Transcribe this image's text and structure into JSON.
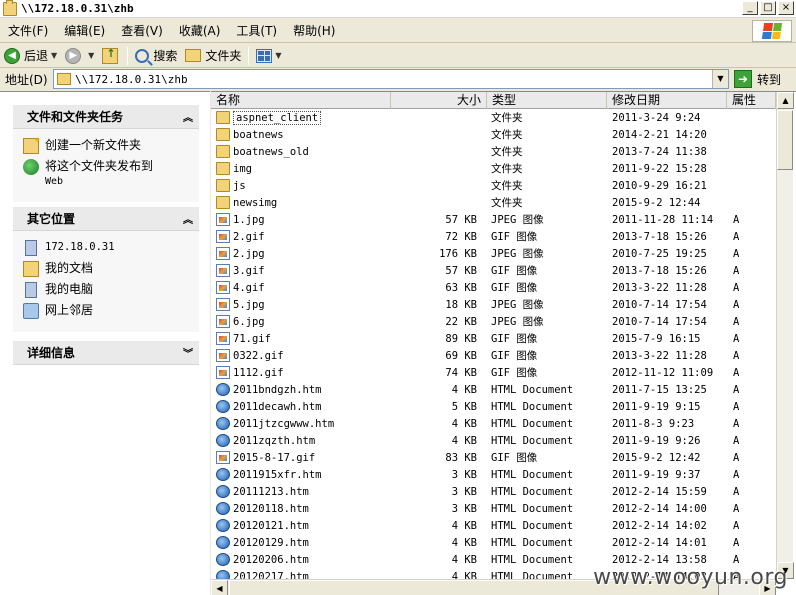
{
  "window": {
    "title": "\\\\172.18.0.31\\zhb"
  },
  "menu": [
    "文件(F)",
    "编辑(E)",
    "查看(V)",
    "收藏(A)",
    "工具(T)",
    "帮助(H)"
  ],
  "toolbar": {
    "back": "后退",
    "search": "搜索",
    "folders": "文件夹"
  },
  "address": {
    "label": "地址(D)",
    "value": "\\\\172.18.0.31\\zhb",
    "go": "转到"
  },
  "tasks": {
    "title": "文件和文件夹任务",
    "items": [
      {
        "label": "创建一个新文件夹",
        "label2": ""
      },
      {
        "label": "将这个文件夹发布到",
        "label2": "Web"
      }
    ]
  },
  "places": {
    "title": "其它位置",
    "items": [
      "172.18.0.31",
      "我的文档",
      "我的电脑",
      "网上邻居"
    ]
  },
  "details": {
    "title": "详细信息"
  },
  "columns": {
    "name": "名称",
    "size": "大小",
    "type": "类型",
    "date": "修改日期",
    "attr": "属性"
  },
  "files": [
    {
      "name": "aspnet_client",
      "size": "",
      "type": "文件夹",
      "date": "2011-3-24 9:24",
      "attr": "",
      "icon": "folder"
    },
    {
      "name": "boatnews",
      "size": "",
      "type": "文件夹",
      "date": "2014-2-21 14:20",
      "attr": "",
      "icon": "folder"
    },
    {
      "name": "boatnews_old",
      "size": "",
      "type": "文件夹",
      "date": "2013-7-24 11:38",
      "attr": "",
      "icon": "folder"
    },
    {
      "name": "img",
      "size": "",
      "type": "文件夹",
      "date": "2011-9-22 15:28",
      "attr": "",
      "icon": "folder"
    },
    {
      "name": "js",
      "size": "",
      "type": "文件夹",
      "date": "2010-9-29 16:21",
      "attr": "",
      "icon": "folder"
    },
    {
      "name": "newsimg",
      "size": "",
      "type": "文件夹",
      "date": "2015-9-2 12:44",
      "attr": "",
      "icon": "folder"
    },
    {
      "name": "1.jpg",
      "size": "57 KB",
      "type": "JPEG 图像",
      "date": "2011-11-28 11:14",
      "attr": "A",
      "icon": "image"
    },
    {
      "name": "2.gif",
      "size": "72 KB",
      "type": "GIF 图像",
      "date": "2013-7-18 15:26",
      "attr": "A",
      "icon": "image"
    },
    {
      "name": "2.jpg",
      "size": "176 KB",
      "type": "JPEG 图像",
      "date": "2010-7-25 19:25",
      "attr": "A",
      "icon": "image"
    },
    {
      "name": "3.gif",
      "size": "57 KB",
      "type": "GIF 图像",
      "date": "2013-7-18 15:26",
      "attr": "A",
      "icon": "image"
    },
    {
      "name": "4.gif",
      "size": "63 KB",
      "type": "GIF 图像",
      "date": "2013-3-22 11:28",
      "attr": "A",
      "icon": "image"
    },
    {
      "name": "5.jpg",
      "size": "18 KB",
      "type": "JPEG 图像",
      "date": "2010-7-14 17:54",
      "attr": "A",
      "icon": "image"
    },
    {
      "name": "6.jpg",
      "size": "22 KB",
      "type": "JPEG 图像",
      "date": "2010-7-14 17:54",
      "attr": "A",
      "icon": "image"
    },
    {
      "name": "71.gif",
      "size": "89 KB",
      "type": "GIF 图像",
      "date": "2015-7-9 16:15",
      "attr": "A",
      "icon": "image"
    },
    {
      "name": "0322.gif",
      "size": "69 KB",
      "type": "GIF 图像",
      "date": "2013-3-22 11:28",
      "attr": "A",
      "icon": "image"
    },
    {
      "name": "1112.gif",
      "size": "74 KB",
      "type": "GIF 图像",
      "date": "2012-11-12 11:09",
      "attr": "A",
      "icon": "image"
    },
    {
      "name": "2011bndgzh.htm",
      "size": "4 KB",
      "type": "HTML Document",
      "date": "2011-7-15 13:25",
      "attr": "A",
      "icon": "html"
    },
    {
      "name": "2011decawh.htm",
      "size": "5 KB",
      "type": "HTML Document",
      "date": "2011-9-19 9:15",
      "attr": "A",
      "icon": "html"
    },
    {
      "name": "2011jtzcgwww.htm",
      "size": "4 KB",
      "type": "HTML Document",
      "date": "2011-8-3 9:23",
      "attr": "A",
      "icon": "html"
    },
    {
      "name": "2011zqzth.htm",
      "size": "4 KB",
      "type": "HTML Document",
      "date": "2011-9-19 9:26",
      "attr": "A",
      "icon": "html"
    },
    {
      "name": "2015-8-17.gif",
      "size": "83 KB",
      "type": "GIF 图像",
      "date": "2015-9-2 12:42",
      "attr": "A",
      "icon": "image"
    },
    {
      "name": "2011915xfr.htm",
      "size": "3 KB",
      "type": "HTML Document",
      "date": "2011-9-19 9:37",
      "attr": "A",
      "icon": "html"
    },
    {
      "name": "20111213.htm",
      "size": "3 KB",
      "type": "HTML Document",
      "date": "2012-2-14 15:59",
      "attr": "A",
      "icon": "html"
    },
    {
      "name": "20120118.htm",
      "size": "3 KB",
      "type": "HTML Document",
      "date": "2012-2-14 14:00",
      "attr": "A",
      "icon": "html"
    },
    {
      "name": "20120121.htm",
      "size": "4 KB",
      "type": "HTML Document",
      "date": "2012-2-14 14:02",
      "attr": "A",
      "icon": "html"
    },
    {
      "name": "20120129.htm",
      "size": "4 KB",
      "type": "HTML Document",
      "date": "2012-2-14 14:01",
      "attr": "A",
      "icon": "html"
    },
    {
      "name": "20120206.htm",
      "size": "4 KB",
      "type": "HTML Document",
      "date": "2012-2-14 13:58",
      "attr": "A",
      "icon": "html"
    },
    {
      "name": "20120217.htm",
      "size": "4 KB",
      "type": "HTML Document",
      "date": "2012-2-14 14:03",
      "attr": "A",
      "icon": "html"
    }
  ],
  "watermark": "www.wooyun.org",
  "colors": {
    "panel_bg": "#f7f7f7",
    "chrome": "#ece9d8",
    "folder": "#f3d37a",
    "go_green": "#3ca338"
  }
}
